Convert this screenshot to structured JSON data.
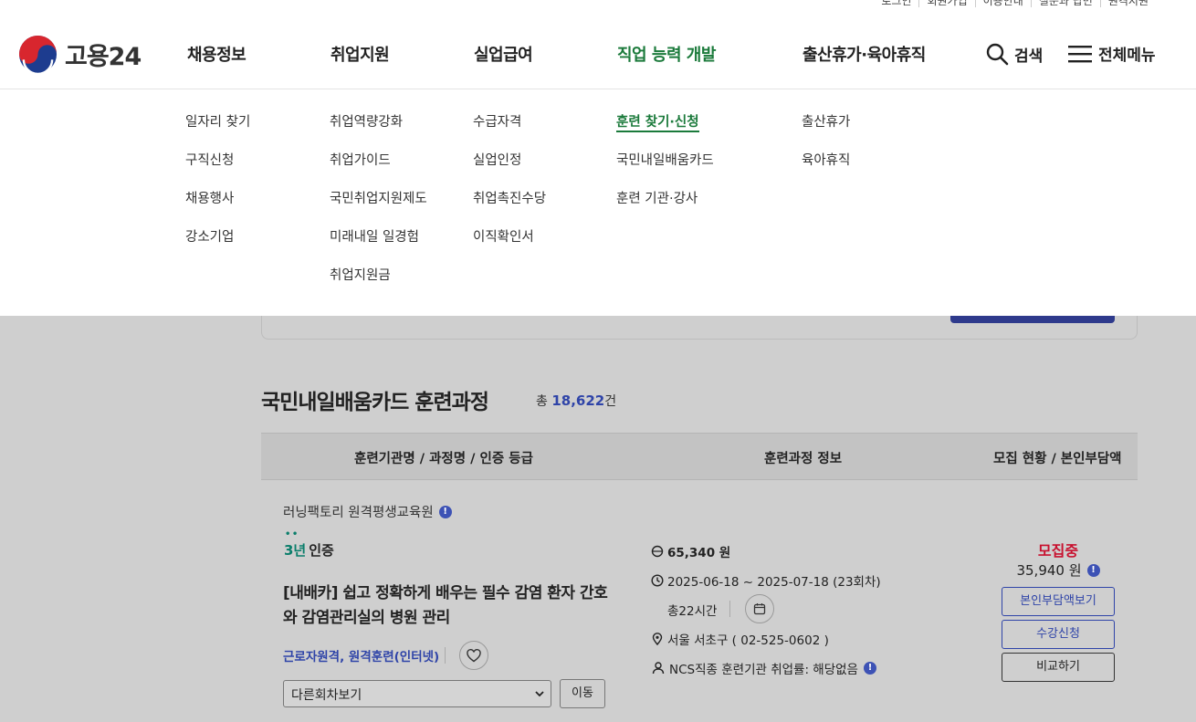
{
  "utility_links": [
    "로그인",
    "회원가입",
    "이용안내",
    "질문과 답변",
    "원격지원"
  ],
  "logo": {
    "text": "고용24",
    "icon": "taegeuk-emblem-icon"
  },
  "gnb": [
    {
      "label": "채용정보"
    },
    {
      "label": "취업지원"
    },
    {
      "label": "실업급여"
    },
    {
      "label": "직업 능력 개발",
      "active": true
    },
    {
      "label": "출산휴가·육아휴직"
    }
  ],
  "search": {
    "label": "검색",
    "icon": "search-icon"
  },
  "all_menu": {
    "label": "전체메뉴",
    "icon": "hamburger-icon"
  },
  "submenu": {
    "col1": [
      "일자리 찾기",
      "구직신청",
      "채용행사",
      "강소기업"
    ],
    "col2": [
      "취업역량강화",
      "취업가이드",
      "국민취업지원제도",
      "미래내일 일경험",
      "취업지원금"
    ],
    "col3": [
      "수급자격",
      "실업인정",
      "취업촉진수당",
      "이직확인서"
    ],
    "col4": [
      "훈련 찾기·신청",
      "국민내일배움카드",
      "훈련 기관·강사"
    ],
    "col5": [
      "출산휴가",
      "육아휴직"
    ],
    "active_item": "훈련 찾기·신청"
  },
  "list": {
    "title": "국민내일배움카드 훈련과정",
    "count_prefix": "총",
    "count": "18,622",
    "count_suffix": "건",
    "headers": [
      "훈련기관명 / 과정명 / 인증 등급",
      "훈련과정 정보",
      "모집 현황 / 본인부담액"
    ]
  },
  "course": {
    "institution": "러닝팩토리 원격평생교육원",
    "cert_year": "3년",
    "cert_label": "인증",
    "title": "[내배카] 쉽고 정확하게 배우는 필수 감염 환자 간호와 감염관리실의 병원 관리",
    "tags": "근로자원격, 원격훈련(인터넷)",
    "round_select": "다른회차보기",
    "move_button": "이동",
    "price": "65,340 원",
    "period": "2025-06-18 ~ 2025-07-18 (23회차)",
    "hours": "총22시간",
    "location": "서울 서초구 ( 02-525-0602 )",
    "employment": "NCS직종 훈련기관 취업률: 해당없음",
    "status": "모집중",
    "self_pay": "35,940 원",
    "buttons": [
      "본인부담액보기",
      "수강신청",
      "비교하기"
    ]
  },
  "colors": {
    "brand_green": "#1b7a3b",
    "accent_blue": "#2f44a8",
    "status_red": "#c8102e",
    "cert_teal": "#0b7e6b"
  }
}
